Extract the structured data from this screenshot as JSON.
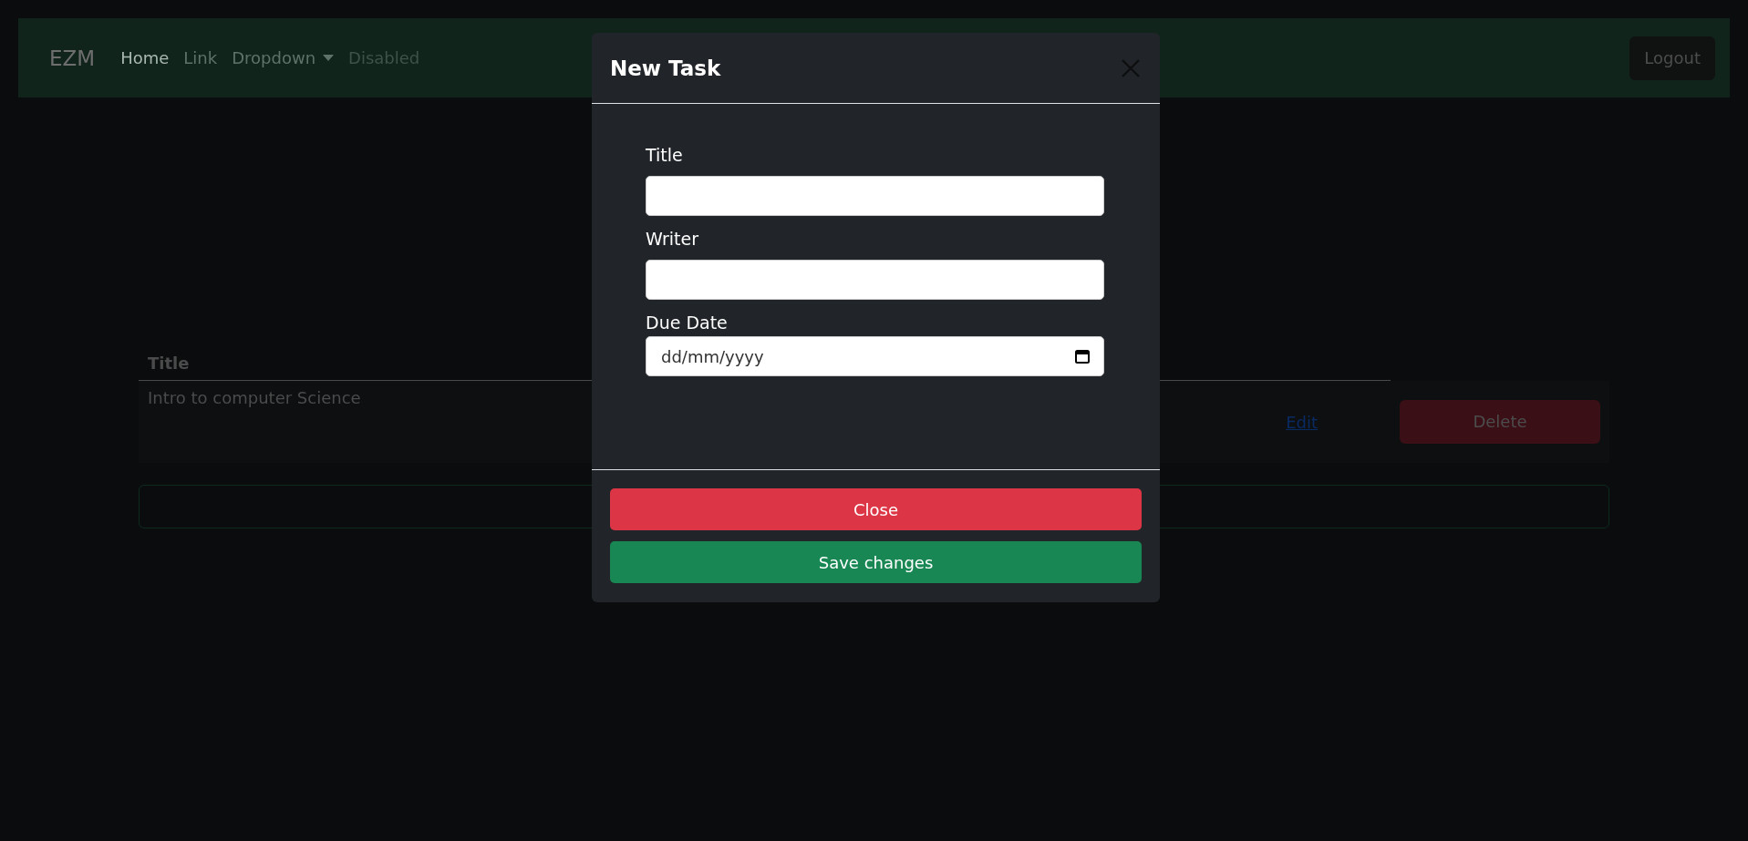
{
  "navbar": {
    "brand": "EZM",
    "items": [
      {
        "label": "Home",
        "kind": "link",
        "selected": true,
        "disabled": false
      },
      {
        "label": "Link",
        "kind": "link",
        "selected": false,
        "disabled": false
      },
      {
        "label": "Dropdown",
        "kind": "dropdown",
        "selected": false,
        "disabled": false
      },
      {
        "label": "Disabled",
        "kind": "link",
        "selected": false,
        "disabled": true
      }
    ],
    "logout": "Logout"
  },
  "table": {
    "columns": [
      "Title"
    ],
    "rows": [
      {
        "title": "Intro to computer Science",
        "edit": "Edit",
        "delete": "Delete"
      }
    ]
  },
  "modal": {
    "title": "New Task",
    "fields": [
      {
        "label": "Title",
        "kind": "text"
      },
      {
        "label": "Writer",
        "kind": "text"
      },
      {
        "label": "Due Date",
        "kind": "date",
        "placeholder": "dd/mm/yyyy"
      }
    ],
    "buttons": [
      {
        "label": "Close",
        "kind": "danger"
      },
      {
        "label": "Save changes",
        "kind": "success"
      }
    ]
  }
}
